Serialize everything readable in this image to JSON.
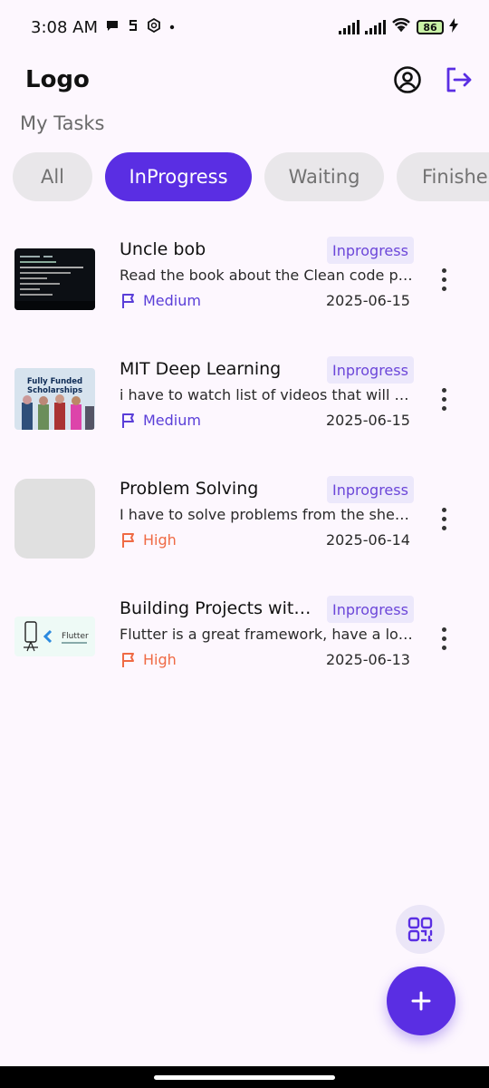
{
  "status_bar": {
    "time": "3:08 AM",
    "battery": "86"
  },
  "app_bar": {
    "logo": "Logo",
    "profile_icon": "account-circle-icon",
    "logout_icon": "logout-icon"
  },
  "section_title": "My Tasks",
  "filters": [
    "All",
    "InProgress",
    "Waiting",
    "Finished"
  ],
  "active_filter": "InProgress",
  "tasks": [
    {
      "title": "Uncle bob",
      "status": "Inprogress",
      "description": "Read the book about the Clean code pl...",
      "priority": "Medium",
      "date": "2025-06-15",
      "thumb_text": ""
    },
    {
      "title": "MIT Deep Learning",
      "status": "Inprogress",
      "description": "i have to watch list of videos that will h...",
      "priority": "Medium",
      "date": "2025-06-15",
      "thumb_text": "Fully Funded Scholarships"
    },
    {
      "title": "Problem Solving",
      "status": "Inprogress",
      "description": "I have to solve problems from the sheet...",
      "priority": "High",
      "date": "2025-06-14",
      "thumb_text": ""
    },
    {
      "title": "Building Projects with fl...",
      "status": "Inprogress",
      "description": "Flutter is a great framework, have a lot ...",
      "priority": "High",
      "date": "2025-06-13",
      "thumb_text": "Flutter"
    }
  ],
  "fab": {
    "qr_icon": "qr-code-icon",
    "add_icon": "plus-icon"
  },
  "colors": {
    "accent": "#5A2EE3",
    "medium": "#5A3ED8",
    "high": "#EF6A44",
    "background": "#FDF7FE"
  }
}
